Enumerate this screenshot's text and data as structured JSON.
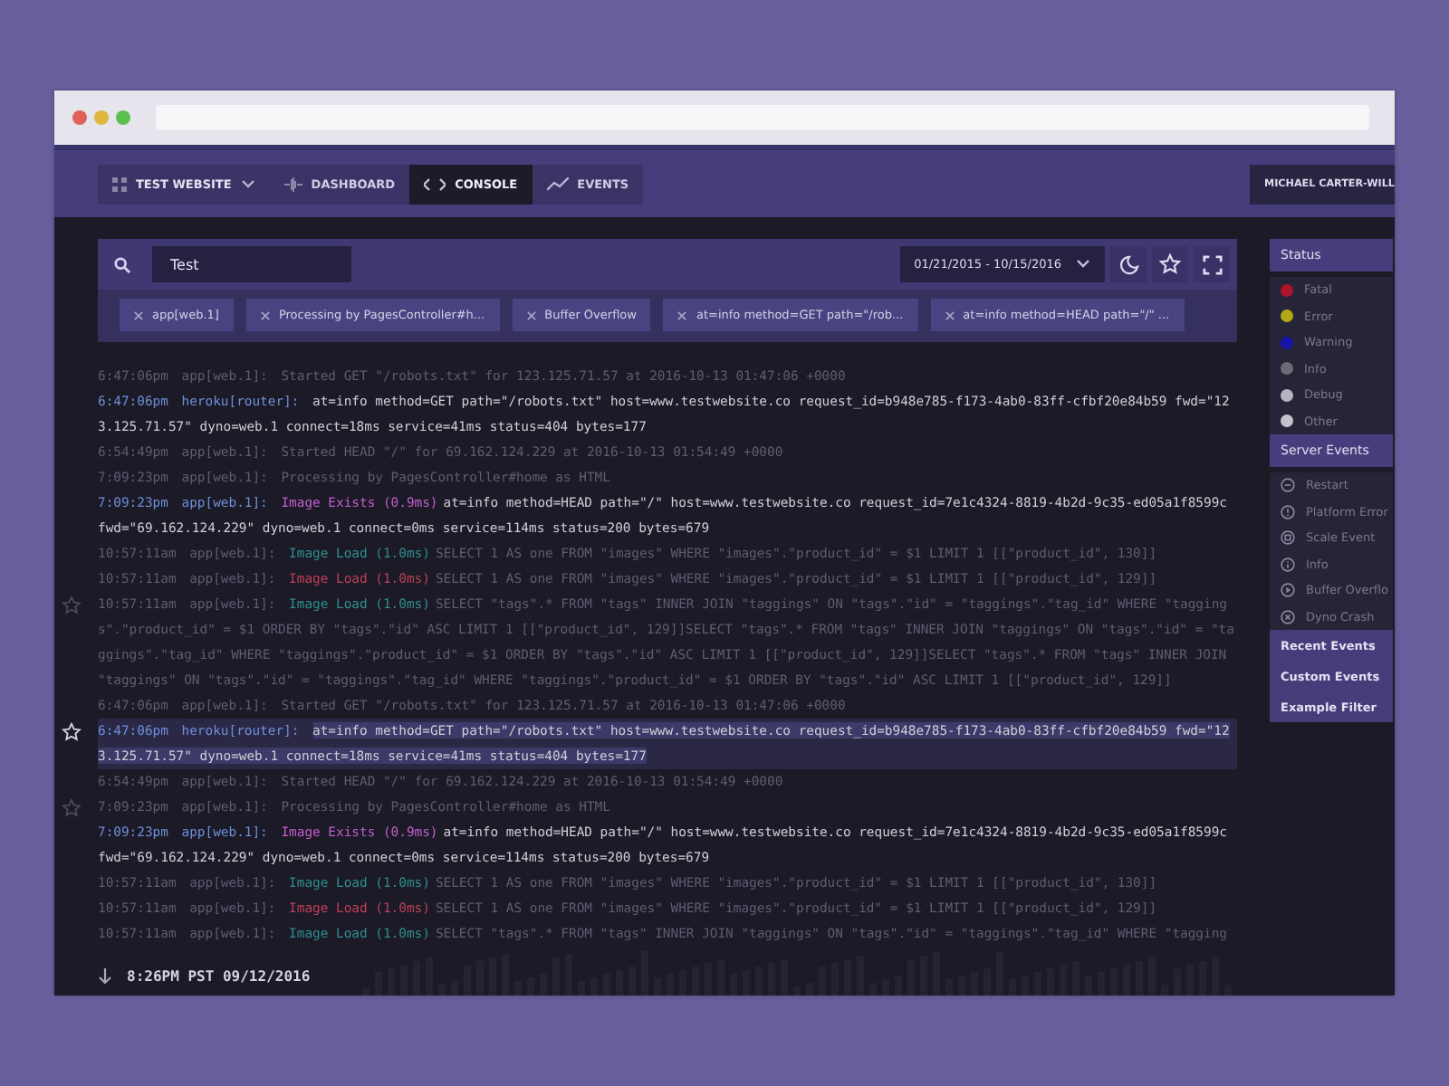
{
  "nav": {
    "site": "TEST WEBSITE",
    "tabs": [
      {
        "label": "DASHBOARD",
        "selected": false
      },
      {
        "label": "CONSOLE",
        "selected": true
      },
      {
        "label": "EVENTS",
        "selected": false
      }
    ],
    "user": "MICHAEL CARTER-WILL"
  },
  "search": {
    "value": "Test"
  },
  "date_range": "01/21/2015 - 10/15/2016",
  "filters": [
    "app[web.1]",
    "Processing by PagesController#h...",
    "Buffer Overflow",
    "at=info method=GET path=\"/rob...",
    "at=info method=HEAD path=\"/\" ..."
  ],
  "logs": [
    {
      "time": "6:47:06pm",
      "source": "app[web.1]:",
      "message": "Started GET \"/robots.txt\" for 123.125.71.57 at 2016-10-13 01:47:06 +0000",
      "dimmed": true,
      "selected": false,
      "starred": false
    },
    {
      "time": "6:47:06pm",
      "source": "heroku[router]:",
      "message": "at=info method=GET path=\"/robots.txt\" host=www.testwebsite.co request_id=b948e785-f173-4ab0-83ff-cfbf20e84b59 fwd=\"123.125.71.57\" dyno=web.1 connect=18ms service=41ms status=404 bytes=177",
      "dimmed": false,
      "selected": false,
      "starred": false
    },
    {
      "time": "6:54:49pm",
      "source": "app[web.1]:",
      "message": "Started HEAD \"/\" for 69.162.124.229 at 2016-10-13 01:54:49 +0000",
      "dimmed": true,
      "selected": false,
      "starred": false
    },
    {
      "time": "7:09:23pm",
      "source": "app[web.1]:",
      "message": "Processing by PagesController#home as HTML",
      "dimmed": true,
      "selected": false,
      "starred": false
    },
    {
      "time": "7:09:23pm",
      "source": "app[web.1]:",
      "tag": {
        "text": "Image Exists (0.9ms)",
        "color": "#c45fd0"
      },
      "message": "at=info method=HEAD path=\"/\" host=www.testwebsite.co request_id=7e1c4324-8819-4b2d-9c35-ed05a1f8599c fwd=\"69.162.124.229\" dyno=web.1 connect=0ms service=114ms status=200 bytes=679",
      "dimmed": false,
      "selected": false,
      "starred": false
    },
    {
      "time": "10:57:11am",
      "source": "app[web.1]:",
      "tag": {
        "text": "Image Load (1.0ms)",
        "color": "#2f8f8f"
      },
      "message": "SELECT 1 AS one FROM \"images\" WHERE \"images\".\"product_id\" = $1 LIMIT 1 [[\"product_id\", 130]]",
      "dimmed": true,
      "selected": false,
      "starred": false
    },
    {
      "time": "10:57:11am",
      "source": "app[web.1]:",
      "tag": {
        "text": "Image Load (1.0ms)",
        "color": "#c0405a"
      },
      "message": "SELECT 1 AS one FROM \"images\" WHERE \"images\".\"product_id\" = $1 LIMIT 1 [[\"product_id\", 129]]",
      "dimmed": true,
      "selected": false,
      "starred": false
    },
    {
      "time": "10:57:11am",
      "source": "app[web.1]:",
      "tag": {
        "text": "Image Load (1.0ms)",
        "color": "#2f8f8f"
      },
      "message": "SELECT \"tags\".* FROM \"tags\" INNER JOIN \"taggings\" ON \"tags\".\"id\" = \"taggings\".\"tag_id\" WHERE \"taggings\".\"product_id\" = $1 ORDER BY \"tags\".\"id\" ASC LIMIT 1 [[\"product_id\", 129]]SELECT \"tags\".* FROM \"tags\" INNER JOIN \"taggings\" ON \"tags\".\"id\" = \"taggings\".\"tag_id\" WHERE \"taggings\".\"product_id\" = $1 ORDER BY \"tags\".\"id\" ASC LIMIT 1 [[\"product_id\", 129]]SELECT \"tags\".* FROM \"tags\" INNER JOIN \"taggings\" ON \"tags\".\"id\" = \"taggings\".\"tag_id\" WHERE \"taggings\".\"product_id\" = $1 ORDER BY \"tags\".\"id\" ASC LIMIT 1 [[\"product_id\", 129]]",
      "dimmed": true,
      "selected": false,
      "starred": true
    },
    {
      "time": "6:47:06pm",
      "source": "app[web.1]:",
      "message": "Started GET \"/robots.txt\" for 123.125.71.57 at 2016-10-13 01:47:06 +0000",
      "dimmed": true,
      "selected": false,
      "starred": false
    },
    {
      "time": "6:47:06pm",
      "source": "heroku[router]:",
      "message": "at=info method=GET path=\"/robots.txt\" host=www.testwebsite.co request_id=b948e785-f173-4ab0-83ff-cfbf20e84b59 fwd=\"123.125.71.57\" dyno=web.1 connect=18ms service=41ms status=404 bytes=177",
      "dimmed": false,
      "selected": true,
      "starred": true
    },
    {
      "time": "6:54:49pm",
      "source": "app[web.1]:",
      "message": "Started HEAD \"/\" for 69.162.124.229 at 2016-10-13 01:54:49 +0000",
      "dimmed": true,
      "selected": false,
      "starred": false
    },
    {
      "time": "7:09:23pm",
      "source": "app[web.1]:",
      "message": "Processing by PagesController#home as HTML",
      "dimmed": true,
      "selected": false,
      "starred": true
    },
    {
      "time": "7:09:23pm",
      "source": "app[web.1]:",
      "tag": {
        "text": "Image Exists (0.9ms)",
        "color": "#c45fd0"
      },
      "message": "at=info method=HEAD path=\"/\" host=www.testwebsite.co request_id=7e1c4324-8819-4b2d-9c35-ed05a1f8599c fwd=\"69.162.124.229\" dyno=web.1 connect=0ms service=114ms status=200 bytes=679",
      "dimmed": false,
      "selected": false,
      "starred": false
    },
    {
      "time": "10:57:11am",
      "source": "app[web.1]:",
      "tag": {
        "text": "Image Load (1.0ms)",
        "color": "#2f8f8f"
      },
      "message": "SELECT 1 AS one FROM \"images\" WHERE \"images\".\"product_id\" = $1 LIMIT 1 [[\"product_id\", 130]]",
      "dimmed": true,
      "selected": false,
      "starred": false
    },
    {
      "time": "10:57:11am",
      "source": "app[web.1]:",
      "tag": {
        "text": "Image Load (1.0ms)",
        "color": "#c0405a"
      },
      "message": "SELECT 1 AS one FROM \"images\" WHERE \"images\".\"product_id\" = $1 LIMIT 1 [[\"product_id\", 129]]",
      "dimmed": true,
      "selected": false,
      "starred": false
    },
    {
      "time": "10:57:11am",
      "source": "app[web.1]:",
      "tag": {
        "text": "Image Load (1.0ms)",
        "color": "#2f8f8f"
      },
      "message": "SELECT \"tags\".* FROM \"tags\" INNER JOIN \"taggings\" ON \"tags\".\"id\" = \"taggings\".\"tag_id\" WHERE \"tagging",
      "dimmed": true,
      "selected": false,
      "starred": false
    }
  ],
  "live": {
    "timestamp": "8:26PM PST 09/12/2016"
  },
  "sidebar": {
    "status_title": "Status",
    "statuses": [
      {
        "label": "Fatal",
        "color": "#b0142a"
      },
      {
        "label": "Error",
        "color": "#b3a817"
      },
      {
        "label": "Warning",
        "color": "#1414a8"
      },
      {
        "label": "Info",
        "color": "#6c6b78"
      },
      {
        "label": "Debug",
        "color": "#b4b3c0"
      },
      {
        "label": "Other",
        "color": "#c4c3cc"
      }
    ],
    "events_title": "Server Events",
    "events": [
      "Restart",
      "Platform Error",
      "Scale Event",
      "Info",
      "Buffer Overflo",
      "Dyno Crash"
    ],
    "links": [
      "Recent Events",
      "Custom Events",
      "Example Filter"
    ]
  }
}
